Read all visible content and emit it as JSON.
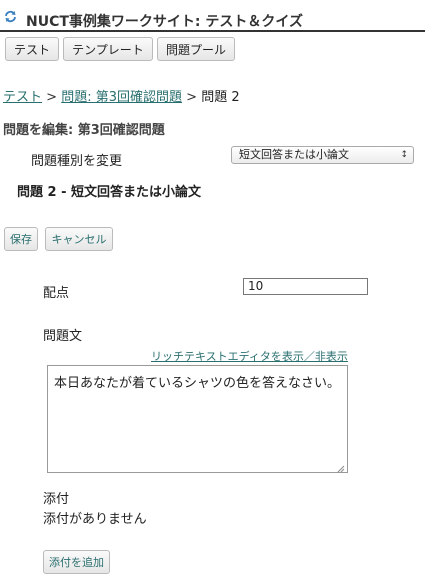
{
  "header": {
    "title": "NUCT事例集ワークサイト: テスト＆クイズ"
  },
  "toolbar": {
    "tests": "テスト",
    "templates": "テンプレート",
    "pool": "問題プール"
  },
  "breadcrumb": {
    "tests": "テスト",
    "question_set": "問題: 第3回確認問題",
    "sep": ">",
    "current": "問題 2"
  },
  "editor": {
    "heading": "問題を編集: 第3回確認問題",
    "change_type_label": "問題種別を変更",
    "type_selected": "短文回答または小論文",
    "question_heading": "問題 2 - 短文回答または小論文",
    "save": "保存",
    "cancel": "キャンセル",
    "points_label": "配点",
    "points_value": "10",
    "question_text_label": "問題文",
    "rich_text_toggle": "リッチテキストエディタを表示／非表示",
    "question_text": "本日あなたが着ているシャツの色を答えなさい。",
    "attachments_label": "添付",
    "no_attachments": "添付がありません",
    "add_attachment": "添付を追加"
  }
}
